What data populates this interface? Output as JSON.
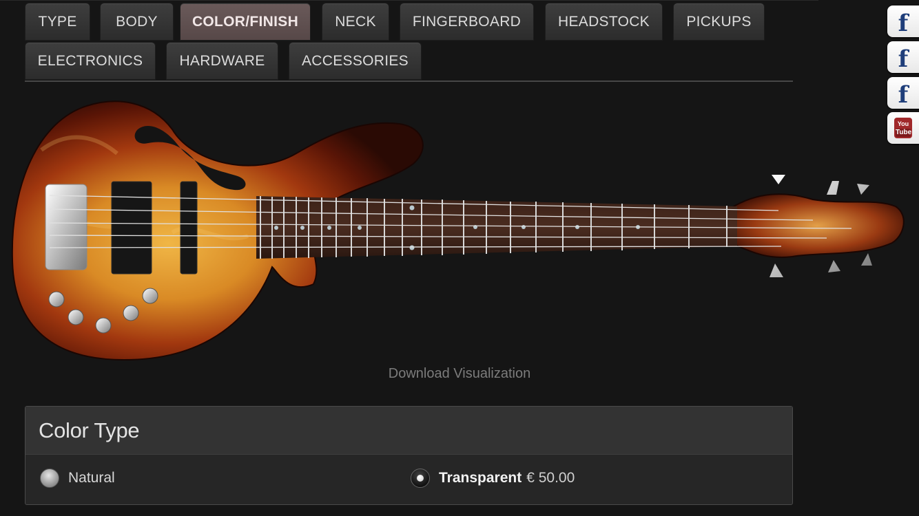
{
  "tabs": [
    {
      "label": "TYPE"
    },
    {
      "label": "BODY"
    },
    {
      "label": "COLOR/FINISH"
    },
    {
      "label": "NECK"
    },
    {
      "label": "FINGERBOARD"
    },
    {
      "label": "HEADSTOCK"
    },
    {
      "label": "PICKUPS"
    },
    {
      "label": "ELECTRONICS"
    },
    {
      "label": "HARDWARE"
    },
    {
      "label": "ACCESSORIES"
    }
  ],
  "active_tab": "COLOR/FINISH",
  "social": [
    {
      "icon": "facebook-icon",
      "glyph": "f"
    },
    {
      "icon": "facebook-icon",
      "glyph": "f"
    },
    {
      "icon": "facebook-icon",
      "glyph": "f"
    },
    {
      "icon": "youtube-icon",
      "line1": "You",
      "line2": "Tube"
    }
  ],
  "download_label": "Download Visualization",
  "color_type": {
    "title": "Color Type",
    "options": [
      {
        "label": "Natural",
        "price": "",
        "selected": false
      },
      {
        "label": "Transparent",
        "price": "€ 50.00",
        "selected": true
      }
    ]
  },
  "colors": {
    "background": "#151515",
    "tab": "#353535",
    "tab_active": "#5f5050",
    "sunburst_center": "#e8a83a",
    "sunburst_edge": "#3a0e05"
  }
}
